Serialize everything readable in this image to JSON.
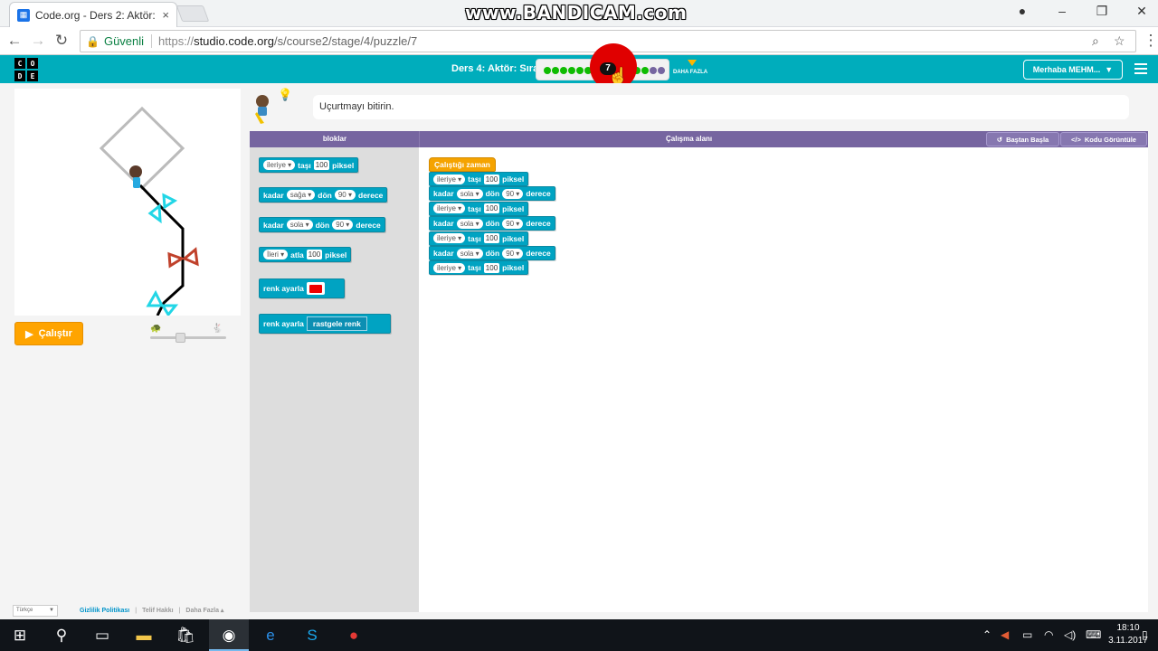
{
  "browser": {
    "tab_title": "Code.org - Ders 2: Aktör:",
    "tab_close": "×",
    "watermark": "www.BANDICAM.com",
    "security_label": "Güvenli",
    "url_scheme": "https://",
    "url_host": "studio.code.org",
    "url_path": "/s/course2/stage/4/puzzle/7"
  },
  "header": {
    "logo_letters": [
      "C",
      "O",
      "D",
      "E"
    ],
    "lesson_title": "Ders 4: Aktör: Sıra",
    "current_puzzle": "7",
    "more_label": "DAHA FAZLA",
    "user_button": "Merhaba MEHM..."
  },
  "progress": {
    "levels": [
      {
        "status": "completed",
        "color": "#0fbc02"
      },
      {
        "status": "completed",
        "color": "#0fbc02"
      },
      {
        "status": "completed",
        "color": "#0fbc02"
      },
      {
        "status": "completed",
        "color": "#0fbc02"
      },
      {
        "status": "completed",
        "color": "#0fbc02"
      },
      {
        "status": "completed",
        "color": "#0fbc02"
      },
      {
        "status": "attempted",
        "color": "#222222"
      },
      {
        "status": "current",
        "color": "#111111"
      },
      {
        "status": "attempted",
        "color": "#222222"
      },
      {
        "status": "attempted",
        "color": "#222222"
      },
      {
        "status": "completed",
        "color": "#0fbc02"
      },
      {
        "status": "completed",
        "color": "#0fbc02"
      },
      {
        "status": "not_tried",
        "color": "#7665a0"
      },
      {
        "status": "not_tried",
        "color": "#7665a0"
      }
    ]
  },
  "stage": {
    "run_button": "Çalıştır",
    "speed_slow_icon": "turtle-icon",
    "speed_fast_icon": "rabbit-icon"
  },
  "instructions": {
    "text": "Uçurtmayı bitirin."
  },
  "workspace_header": {
    "toolbox_title": "bloklar",
    "workspace_title": "Çalışma alanı",
    "reset_button": "Baştan Başla",
    "show_code_button": "Kodu Görüntüle"
  },
  "toolbox": {
    "move_forward": {
      "dir": "ileriye ▾",
      "verb": "taşı",
      "value": "100",
      "unit": "piksel"
    },
    "turn_right": {
      "pre": "kadar",
      "dir": "sağa ▾",
      "verb": "dön",
      "value": "90 ▾",
      "unit": "derece"
    },
    "turn_left": {
      "pre": "kadar",
      "dir": "sola ▾",
      "verb": "dön",
      "value": "90 ▾",
      "unit": "derece"
    },
    "jump": {
      "dir": "İleri ▾",
      "verb": "atla",
      "value": "100",
      "unit": "piksel"
    },
    "set_color": {
      "label": "renk ayarla"
    },
    "set_color_random": {
      "label": "renk ayarla",
      "value": "rastgele renk"
    }
  },
  "program": {
    "event": "Çalıştığı zaman",
    "blocks": [
      {
        "pre": "",
        "dir": "ileriye ▾",
        "verb": "taşı",
        "value": "100",
        "unit": "piksel"
      },
      {
        "pre": "kadar",
        "dir": "sola ▾",
        "verb": "dön",
        "value": "90 ▾",
        "unit": "derece"
      },
      {
        "pre": "",
        "dir": "ileriye ▾",
        "verb": "taşı",
        "value": "100",
        "unit": "piksel"
      },
      {
        "pre": "kadar",
        "dir": "sola ▾",
        "verb": "dön",
        "value": "90 ▾",
        "unit": "derece"
      },
      {
        "pre": "",
        "dir": "ileriye ▾",
        "verb": "taşı",
        "value": "100",
        "unit": "piksel"
      },
      {
        "pre": "kadar",
        "dir": "sola ▾",
        "verb": "dön",
        "value": "90 ▾",
        "unit": "derece"
      },
      {
        "pre": "",
        "dir": "ileriye ▾",
        "verb": "taşı",
        "value": "100",
        "unit": "piksel"
      }
    ]
  },
  "footer": {
    "language": "Türkçe",
    "privacy": "Gizlilik Politikası",
    "sep": "|",
    "copyright": "Telif Hakkı",
    "more": "Daha Fazla ▴"
  },
  "taskbar": {
    "time": "18:10",
    "date": "3.11.2017"
  },
  "colors": {
    "header_teal": "#00adbc",
    "block_teal": "#00a3c2",
    "event_orange": "#f5a300",
    "workspace_purple": "#7665a0",
    "run_orange": "#ffa400"
  }
}
